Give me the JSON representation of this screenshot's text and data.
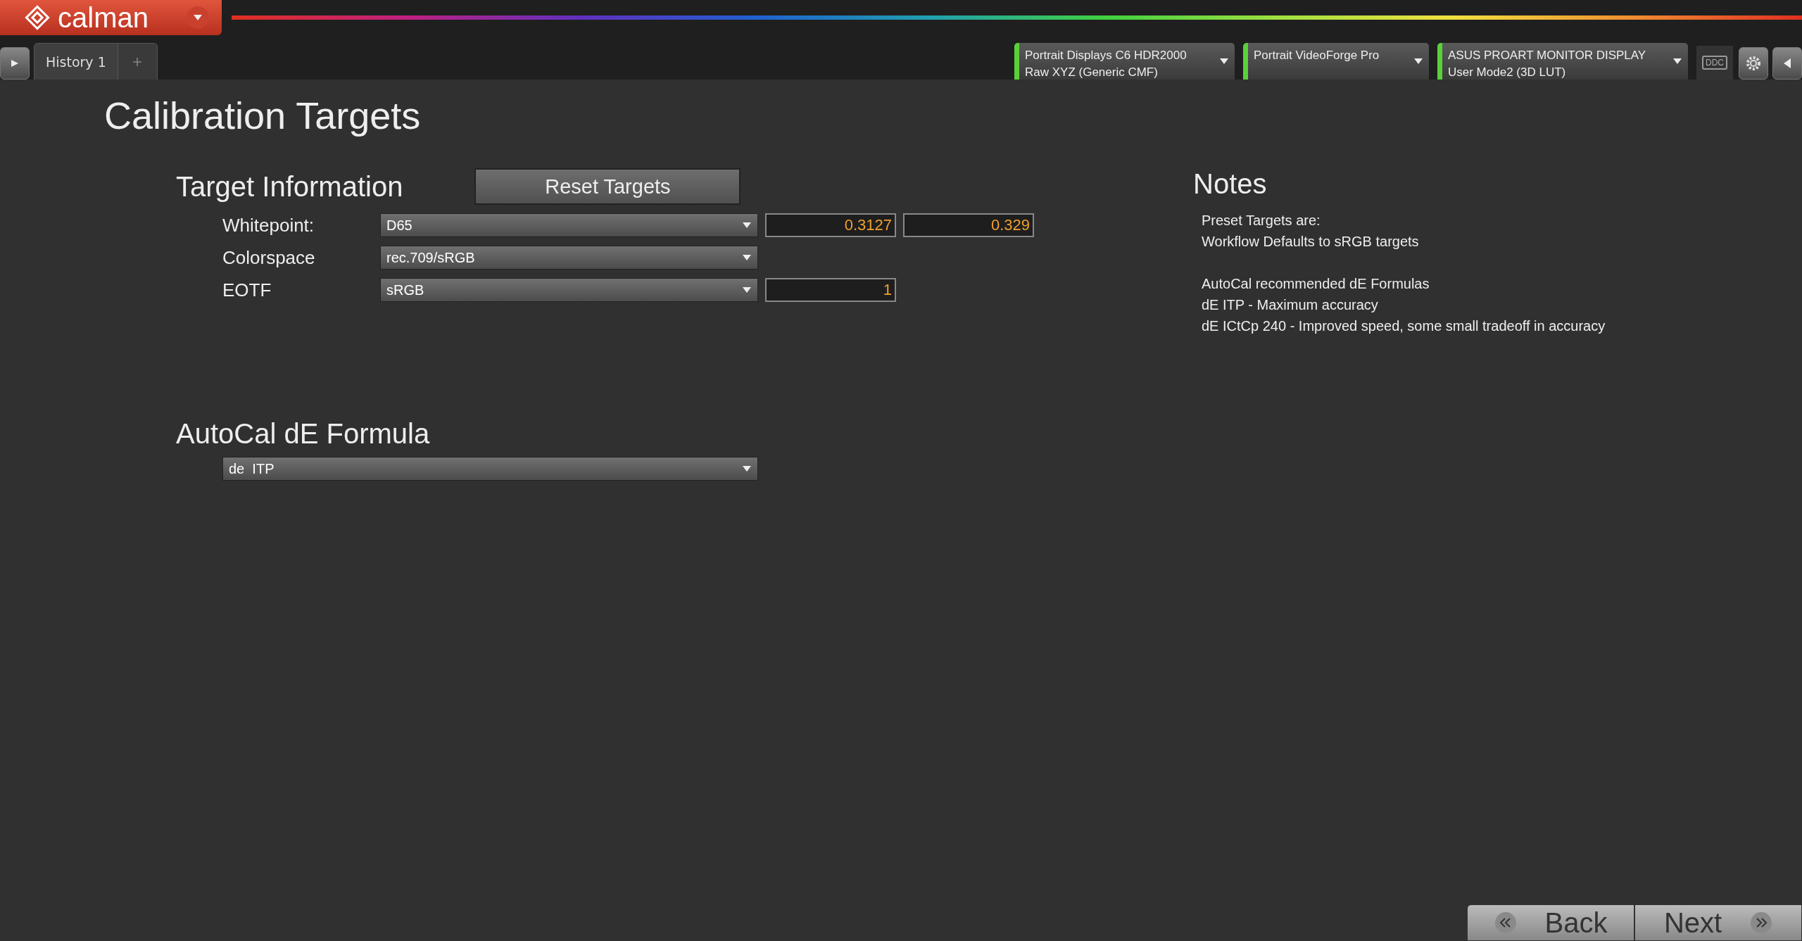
{
  "app": {
    "logo": "calman"
  },
  "tabs": [
    {
      "label": "History 1",
      "selected": true
    }
  ],
  "devices": [
    {
      "line1": "Portrait Displays C6 HDR2000",
      "line2": "Raw XYZ (Generic CMF)"
    },
    {
      "line1": "Portrait VideoForge Pro"
    },
    {
      "line1": "ASUS PROART MONITOR DISPLAY",
      "line2": "User Mode2 (3D LUT)"
    }
  ],
  "ddc_label": "DDC",
  "page_title": "Calibration Targets",
  "target_information": {
    "heading": "Target Information",
    "reset_button": "Reset Targets",
    "rows": [
      {
        "label": "Whitepoint:",
        "value": "D65",
        "fields": [
          "0.3127",
          "0.329"
        ]
      },
      {
        "label": "Colorspace",
        "value": "rec.709/sRGB",
        "fields": []
      },
      {
        "label": "EOTF",
        "value": "sRGB",
        "fields": [
          "1"
        ]
      }
    ]
  },
  "formula": {
    "heading": "AutoCal dE Formula",
    "value": "de  ITP"
  },
  "notes": {
    "heading": "Notes",
    "paragraphs": [
      [
        "Preset Targets are:",
        "Workflow Defaults to sRGB targets"
      ],
      [
        "AutoCal recommended dE Formulas",
        "dE ITP - Maximum accuracy",
        "dE ICtCp 240 - Improved speed, some small tradeoff in accuracy"
      ]
    ]
  },
  "nav": {
    "back": "Back",
    "next": "Next"
  }
}
